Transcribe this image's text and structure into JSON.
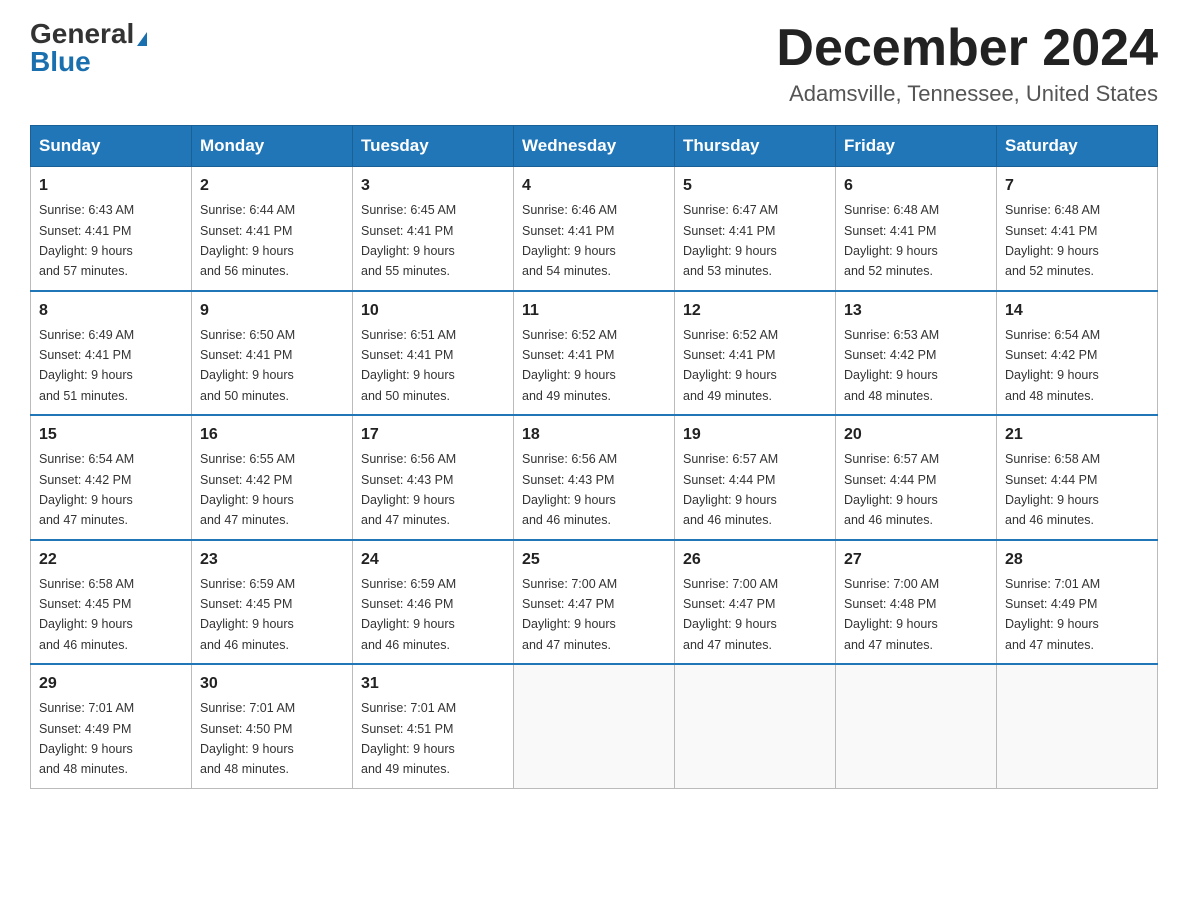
{
  "header": {
    "logo_general": "General",
    "logo_blue": "Blue",
    "month_title": "December 2024",
    "location": "Adamsville, Tennessee, United States"
  },
  "weekdays": [
    "Sunday",
    "Monday",
    "Tuesday",
    "Wednesday",
    "Thursday",
    "Friday",
    "Saturday"
  ],
  "weeks": [
    [
      {
        "day": "1",
        "sunrise": "6:43 AM",
        "sunset": "4:41 PM",
        "daylight": "9 hours and 57 minutes."
      },
      {
        "day": "2",
        "sunrise": "6:44 AM",
        "sunset": "4:41 PM",
        "daylight": "9 hours and 56 minutes."
      },
      {
        "day": "3",
        "sunrise": "6:45 AM",
        "sunset": "4:41 PM",
        "daylight": "9 hours and 55 minutes."
      },
      {
        "day": "4",
        "sunrise": "6:46 AM",
        "sunset": "4:41 PM",
        "daylight": "9 hours and 54 minutes."
      },
      {
        "day": "5",
        "sunrise": "6:47 AM",
        "sunset": "4:41 PM",
        "daylight": "9 hours and 53 minutes."
      },
      {
        "day": "6",
        "sunrise": "6:48 AM",
        "sunset": "4:41 PM",
        "daylight": "9 hours and 52 minutes."
      },
      {
        "day": "7",
        "sunrise": "6:48 AM",
        "sunset": "4:41 PM",
        "daylight": "9 hours and 52 minutes."
      }
    ],
    [
      {
        "day": "8",
        "sunrise": "6:49 AM",
        "sunset": "4:41 PM",
        "daylight": "9 hours and 51 minutes."
      },
      {
        "day": "9",
        "sunrise": "6:50 AM",
        "sunset": "4:41 PM",
        "daylight": "9 hours and 50 minutes."
      },
      {
        "day": "10",
        "sunrise": "6:51 AM",
        "sunset": "4:41 PM",
        "daylight": "9 hours and 50 minutes."
      },
      {
        "day": "11",
        "sunrise": "6:52 AM",
        "sunset": "4:41 PM",
        "daylight": "9 hours and 49 minutes."
      },
      {
        "day": "12",
        "sunrise": "6:52 AM",
        "sunset": "4:41 PM",
        "daylight": "9 hours and 49 minutes."
      },
      {
        "day": "13",
        "sunrise": "6:53 AM",
        "sunset": "4:42 PM",
        "daylight": "9 hours and 48 minutes."
      },
      {
        "day": "14",
        "sunrise": "6:54 AM",
        "sunset": "4:42 PM",
        "daylight": "9 hours and 48 minutes."
      }
    ],
    [
      {
        "day": "15",
        "sunrise": "6:54 AM",
        "sunset": "4:42 PM",
        "daylight": "9 hours and 47 minutes."
      },
      {
        "day": "16",
        "sunrise": "6:55 AM",
        "sunset": "4:42 PM",
        "daylight": "9 hours and 47 minutes."
      },
      {
        "day": "17",
        "sunrise": "6:56 AM",
        "sunset": "4:43 PM",
        "daylight": "9 hours and 47 minutes."
      },
      {
        "day": "18",
        "sunrise": "6:56 AM",
        "sunset": "4:43 PM",
        "daylight": "9 hours and 46 minutes."
      },
      {
        "day": "19",
        "sunrise": "6:57 AM",
        "sunset": "4:44 PM",
        "daylight": "9 hours and 46 minutes."
      },
      {
        "day": "20",
        "sunrise": "6:57 AM",
        "sunset": "4:44 PM",
        "daylight": "9 hours and 46 minutes."
      },
      {
        "day": "21",
        "sunrise": "6:58 AM",
        "sunset": "4:44 PM",
        "daylight": "9 hours and 46 minutes."
      }
    ],
    [
      {
        "day": "22",
        "sunrise": "6:58 AM",
        "sunset": "4:45 PM",
        "daylight": "9 hours and 46 minutes."
      },
      {
        "day": "23",
        "sunrise": "6:59 AM",
        "sunset": "4:45 PM",
        "daylight": "9 hours and 46 minutes."
      },
      {
        "day": "24",
        "sunrise": "6:59 AM",
        "sunset": "4:46 PM",
        "daylight": "9 hours and 46 minutes."
      },
      {
        "day": "25",
        "sunrise": "7:00 AM",
        "sunset": "4:47 PM",
        "daylight": "9 hours and 47 minutes."
      },
      {
        "day": "26",
        "sunrise": "7:00 AM",
        "sunset": "4:47 PM",
        "daylight": "9 hours and 47 minutes."
      },
      {
        "day": "27",
        "sunrise": "7:00 AM",
        "sunset": "4:48 PM",
        "daylight": "9 hours and 47 minutes."
      },
      {
        "day": "28",
        "sunrise": "7:01 AM",
        "sunset": "4:49 PM",
        "daylight": "9 hours and 47 minutes."
      }
    ],
    [
      {
        "day": "29",
        "sunrise": "7:01 AM",
        "sunset": "4:49 PM",
        "daylight": "9 hours and 48 minutes."
      },
      {
        "day": "30",
        "sunrise": "7:01 AM",
        "sunset": "4:50 PM",
        "daylight": "9 hours and 48 minutes."
      },
      {
        "day": "31",
        "sunrise": "7:01 AM",
        "sunset": "4:51 PM",
        "daylight": "9 hours and 49 minutes."
      },
      null,
      null,
      null,
      null
    ]
  ]
}
